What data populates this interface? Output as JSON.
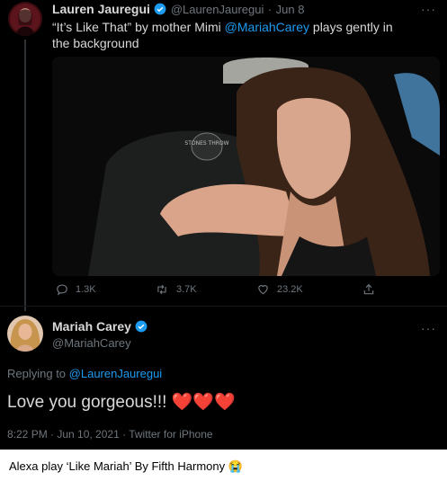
{
  "tweet1": {
    "author_name": "Lauren Jauregui",
    "author_handle": "@LaurenJauregui",
    "date_sep": "·",
    "date": "Jun 8",
    "text_before": "“It’s Like That” by mother Mimi ",
    "mention": "@MariahCarey",
    "text_after": " plays gently in the background",
    "photo_hat_text": "STONES THROW",
    "actions": {
      "reply_count": "1.3K",
      "retweet_count": "3.7K",
      "like_count": "23.2K"
    }
  },
  "tweet2": {
    "author_name": "Mariah Carey",
    "author_handle": "@MariahCarey",
    "replying_label": "Replying to ",
    "replying_to": "@LaurenJauregui",
    "text": "Love you gorgeous!!! ",
    "hearts": "❤️❤️❤️",
    "timestamp": "8:22 PM · Jun 10, 2021 · Twitter for iPhone"
  },
  "more_glyph": "···",
  "caption": {
    "text": "Alexa play ‘Like Mariah’ By Fifth Harmony ",
    "emoji": "😭"
  },
  "colors": {
    "background": "#000000",
    "text": "#d9d9d9",
    "muted": "#6e767d",
    "link": "#1d9bf0",
    "verified": "#1d9bf0",
    "heart": "#e0245e"
  },
  "icons": [
    "verified-badge-icon",
    "reply-icon",
    "retweet-icon",
    "like-icon",
    "share-icon",
    "more-icon"
  ]
}
